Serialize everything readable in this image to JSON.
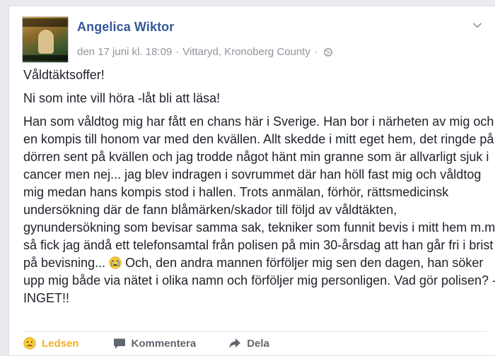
{
  "post": {
    "author": "Angelica Wiktor",
    "date": "den 17 juni kl. 18:09",
    "separator": "·",
    "location": "Vittaryd, Kronoberg County",
    "separator2": "·",
    "privacy_icon": "globe-icon",
    "menu_icon": "chevron-down-icon",
    "paragraphs": [
      "Våldtäktsoffer!",
      "Ni som inte vill höra -låt bli att läsa!",
      "Han som våldtog mig har fått en chans här i Sverige. Han bor i närheten av mig och en kompis till honom var med den kvällen. Allt skedde i mitt eget hem, det ringde på dörren sent på kvällen och jag trodde något hänt min granne som är allvarligt sjuk i cancer men nej... jag blev indragen i sovrummet där han höll fast mig och våldtog mig medan hans kompis stod i hallen. Trots anmälan, förhör, rättsmedicinsk undersökning där de fann blåmärken/skador till följd av våldtäkten, gynundersökning som bevisar samma sak, tekniker som funnit bevis i mitt hem m.m så fick jag ändå ett telefonsamtal från polisen på min 30-årsdag att han går fri i brist på bevisning...",
      "Och, den andra mannen förföljer mig sen den dagen, han söker upp mig både via nätet i olika namn och förföljer mig personligen. Vad gör polisen? -INGET!!"
    ],
    "inline_emoji": "crying-face-icon"
  },
  "actions": {
    "reaction_label": "Ledsen",
    "reaction_icon": "sad-face-icon",
    "comment_label": "Kommentera",
    "comment_icon": "comment-bubble-icon",
    "share_label": "Dela",
    "share_icon": "share-arrow-icon"
  },
  "colors": {
    "author_blue": "#365899",
    "meta_grey": "#90949c",
    "text": "#1d2129",
    "reaction_yellow": "#f7b125",
    "action_grey": "#606770"
  }
}
